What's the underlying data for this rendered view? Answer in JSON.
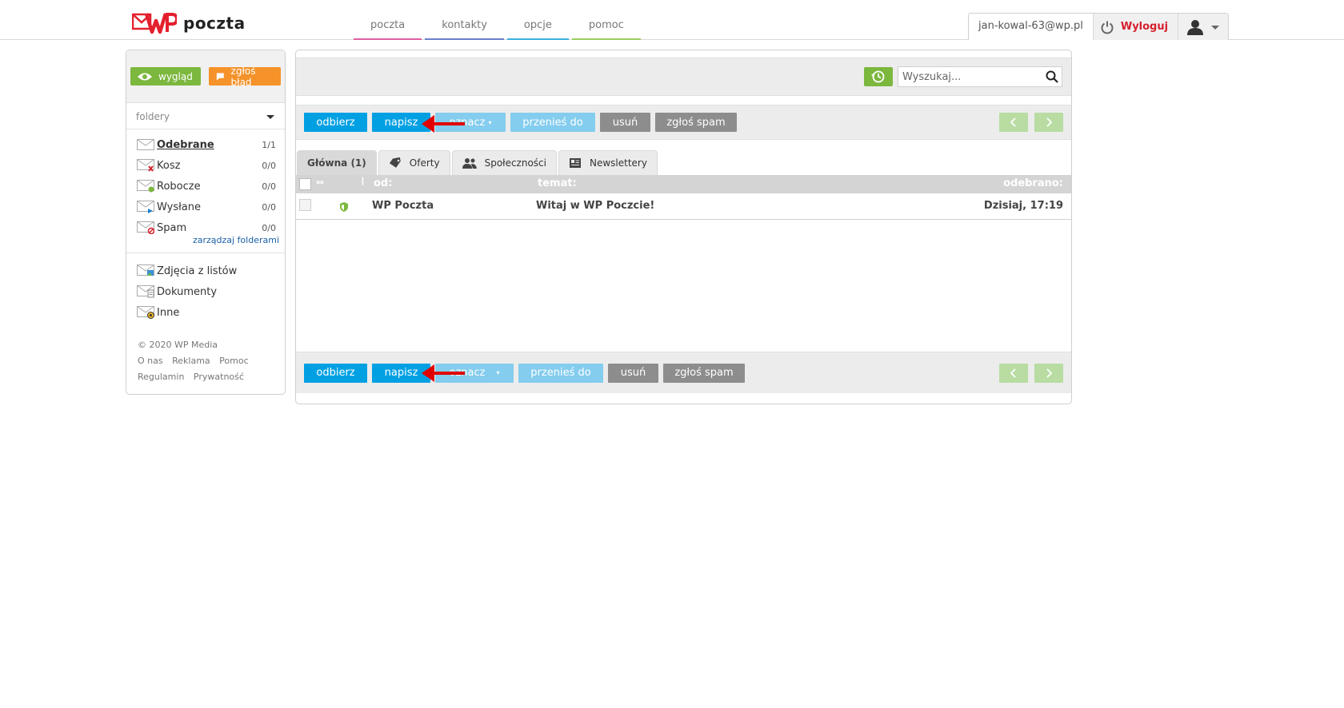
{
  "brand": {
    "name": "poczta",
    "logo_text": "WP"
  },
  "nav": [
    {
      "label": "poczta",
      "color": "#e25fa2"
    },
    {
      "label": "kontakty",
      "color": "#6b7fc9"
    },
    {
      "label": "opcje",
      "color": "#3bb0dd"
    },
    {
      "label": "pomoc",
      "color": "#9acd5e"
    }
  ],
  "user": {
    "email": "jan-kowal-63@wp.pl",
    "logout_label": "Wyloguj"
  },
  "sidebar": {
    "view_button": "wygląd",
    "report_button": "zgłoś błąd",
    "folders_label": "foldery",
    "folders": [
      {
        "label": "Odebrane",
        "count": "1/1",
        "icon": "envelope-icon"
      },
      {
        "label": "Kosz",
        "count": "0/0",
        "icon": "trash-envelope-icon"
      },
      {
        "label": "Robocze",
        "count": "0/0",
        "icon": "draft-envelope-icon"
      },
      {
        "label": "Wysłane",
        "count": "0/0",
        "icon": "sent-envelope-icon"
      },
      {
        "label": "Spam",
        "count": "0/0",
        "icon": "spam-envelope-icon"
      }
    ],
    "manage_folders": "zarządzaj folderami",
    "categories": [
      {
        "label": "Zdjęcia z listów",
        "icon": "photo-envelope-icon"
      },
      {
        "label": "Dokumenty",
        "icon": "document-envelope-icon"
      },
      {
        "label": "Inne",
        "icon": "other-envelope-icon"
      }
    ],
    "footer": {
      "copyright": "© 2020 WP Media",
      "links_row1": [
        "O nas",
        "Reklama",
        "Pomoc"
      ],
      "links_row2": [
        "Regulamin",
        "Prywatność"
      ]
    }
  },
  "search": {
    "placeholder": "Wyszukaj..."
  },
  "toolbar": {
    "receive": "odbierz",
    "compose": "napisz",
    "mark": "oznacz",
    "move": "przenieś do",
    "delete": "usuń",
    "spam": "zgłoś spam"
  },
  "tabs": [
    {
      "label": "Główna (1)",
      "icon": ""
    },
    {
      "label": "Oferty",
      "icon": "tag-icon"
    },
    {
      "label": "Społeczności",
      "icon": "people-icon"
    },
    {
      "label": "Newslettery",
      "icon": "newspaper-icon"
    }
  ],
  "table": {
    "headers": {
      "from": "od:",
      "subject": "temat:",
      "received": "odebrano:"
    },
    "rows": [
      {
        "from": "WP Poczta",
        "subject": "Witaj w WP Poczcie!",
        "received": "Dzisiaj, 17:19"
      }
    ]
  },
  "colors": {
    "accent_blue": "#00a0e3",
    "accent_green": "#7cb73e",
    "accent_orange": "#f5922a",
    "logout_red": "#d6202e"
  }
}
